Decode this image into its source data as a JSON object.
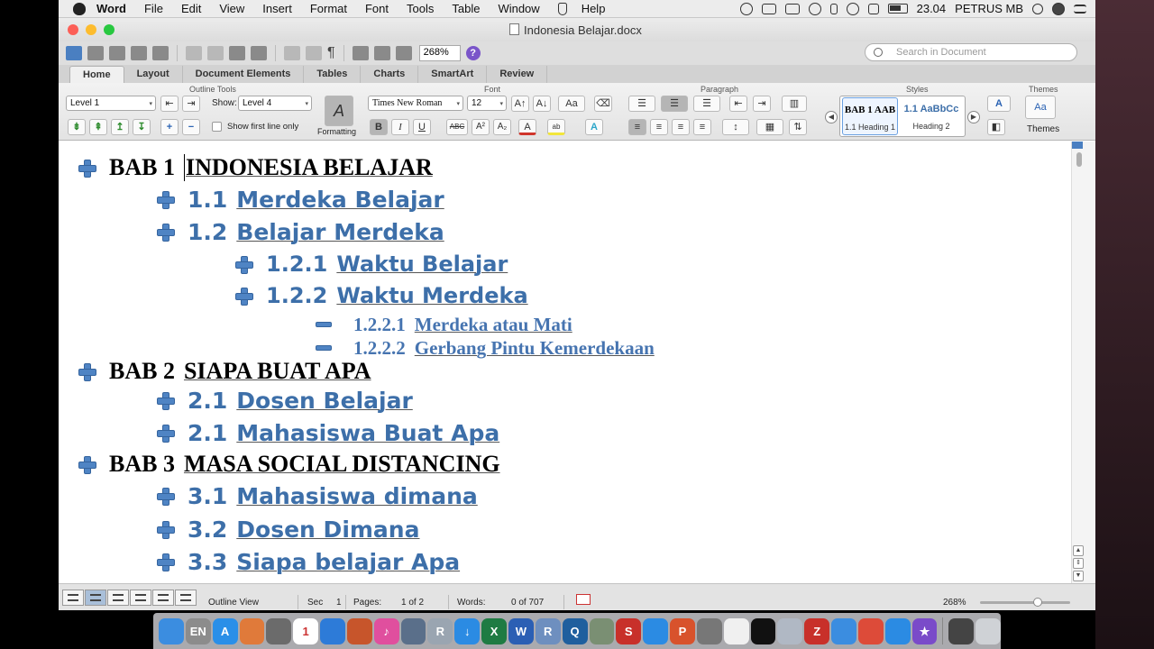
{
  "menubar": {
    "app": "Word",
    "items": [
      "File",
      "Edit",
      "View",
      "Insert",
      "Format",
      "Font",
      "Tools",
      "Table",
      "Window",
      "Help"
    ],
    "time": "23.04",
    "user": "PETRUS MB"
  },
  "window": {
    "title": "Indonesia Belajar.docx",
    "zoom": "268%",
    "search_placeholder": "Search in Document"
  },
  "ribbon": {
    "tabs": [
      "Home",
      "Layout",
      "Document Elements",
      "Tables",
      "Charts",
      "SmartArt",
      "Review"
    ],
    "groups": {
      "outline_tools": "Outline Tools",
      "font": "Font",
      "paragraph": "Paragraph",
      "styles": "Styles",
      "themes": "Themes"
    },
    "level_value": "Level 1",
    "show_label": "Show:",
    "show_value": "Level 4",
    "show_first_line": "Show first line only",
    "formatting_label": "Formatting",
    "font_name": "Times New Roman",
    "font_size": "12",
    "styles": [
      {
        "preview": "BAB 1  AAB",
        "caption": "1.1 Heading 1"
      },
      {
        "preview": "1.1  AaBbCc",
        "caption": "Heading 2"
      }
    ],
    "themes_label": "Themes",
    "buttons": {
      "bold": "B",
      "italic": "I",
      "underline": "U",
      "strike": "ABC",
      "superscript": "A²",
      "subscript": "A₂",
      "pilcrow": "¶",
      "themes_aa": "Aa",
      "font_aa": "A",
      "nav_prev": "◀",
      "nav_next": "▶",
      "help": "?",
      "dropdown_arrow": "▾",
      "scroll_up": "▲",
      "scroll_down": "▼",
      "scroll_updown": "⇕"
    }
  },
  "outline": [
    {
      "level": 1,
      "marker": "plus",
      "number": "BAB 1",
      "text": "INDONESIA BELAJAR"
    },
    {
      "level": 2,
      "marker": "plus",
      "number": "1.1",
      "text": "Merdeka Belajar"
    },
    {
      "level": 2,
      "marker": "plus",
      "number": "1.2",
      "text": "Belajar Merdeka"
    },
    {
      "level": 3,
      "marker": "plus",
      "number": "1.2.1",
      "text": "Waktu Belajar"
    },
    {
      "level": 3,
      "marker": "plus",
      "number": "1.2.2",
      "text": "Waktu Merdeka"
    },
    {
      "level": 4,
      "marker": "minus",
      "number": "1.2.2.1",
      "text": "Merdeka atau Mati"
    },
    {
      "level": 4,
      "marker": "minus",
      "number": "1.2.2.2",
      "text": "Gerbang Pintu Kemerdekaan"
    },
    {
      "level": 1,
      "marker": "plus",
      "number": "BAB 2",
      "text": "SIAPA BUAT APA"
    },
    {
      "level": 2,
      "marker": "plus",
      "number": "2.1",
      "text": "Dosen Belajar"
    },
    {
      "level": 2,
      "marker": "plus",
      "number": "2.1",
      "text": "Mahasiswa Buat Apa"
    },
    {
      "level": 1,
      "marker": "plus",
      "number": "BAB 3",
      "text": "MASA SOCIAL DISTANCING"
    },
    {
      "level": 2,
      "marker": "plus",
      "number": "3.1",
      "text": "Mahasiswa dimana"
    },
    {
      "level": 2,
      "marker": "plus",
      "number": "3.2",
      "text": "Dosen Dimana"
    },
    {
      "level": 2,
      "marker": "plus",
      "number": "3.3",
      "text": "Siapa belajar Apa"
    }
  ],
  "statusbar": {
    "view": "Outline View",
    "sec_label": "Sec",
    "sec_value": "1",
    "pages_label": "Pages:",
    "pages_value": "1 of 2",
    "words_label": "Words:",
    "words_value": "0 of 707",
    "zoom": "268%"
  },
  "dock": {
    "apps": [
      {
        "name": "finder",
        "glyph": "",
        "color": "#3b8de0"
      },
      {
        "name": "keyboard-en",
        "glyph": "EN",
        "color": "#8c8c8c"
      },
      {
        "name": "app-store",
        "glyph": "A",
        "color": "#2a8fe8"
      },
      {
        "name": "photos",
        "glyph": "",
        "color": "#e07a3a"
      },
      {
        "name": "brush",
        "glyph": "",
        "color": "#6b6b6b"
      },
      {
        "name": "calendar",
        "glyph": "1",
        "color": "#ffffff"
      },
      {
        "name": "keynote",
        "glyph": "",
        "color": "#2d7bd8"
      },
      {
        "name": "presentation",
        "glyph": "",
        "color": "#c7552b"
      },
      {
        "name": "itunes",
        "glyph": "♪",
        "color": "#e04f9e"
      },
      {
        "name": "scanner",
        "glyph": "",
        "color": "#5a6f8a"
      },
      {
        "name": "r-studio",
        "glyph": "R",
        "color": "#9aa5b1"
      },
      {
        "name": "downloader",
        "glyph": "↓",
        "color": "#2b8be3"
      },
      {
        "name": "excel",
        "glyph": "X",
        "color": "#1e7b43"
      },
      {
        "name": "word",
        "glyph": "W",
        "color": "#2b5fb4"
      },
      {
        "name": "r-app",
        "glyph": "R",
        "color": "#6e8fbf"
      },
      {
        "name": "quicktime",
        "glyph": "Q",
        "color": "#1f5f9e"
      },
      {
        "name": "network",
        "glyph": "",
        "color": "#7a8f73"
      },
      {
        "name": "presentation-red",
        "glyph": "S",
        "color": "#c8302a"
      },
      {
        "name": "safari",
        "glyph": "",
        "color": "#2b8be3"
      },
      {
        "name": "powerpoint",
        "glyph": "P",
        "color": "#d8522c"
      },
      {
        "name": "tools",
        "glyph": "",
        "color": "#777"
      },
      {
        "name": "notepad",
        "glyph": "",
        "color": "#f0f0f0"
      },
      {
        "name": "terminal",
        "glyph": "",
        "color": "#111"
      },
      {
        "name": "preview",
        "glyph": "",
        "color": "#b0b8c4"
      },
      {
        "name": "zotero",
        "glyph": "Z",
        "color": "#c8302a"
      },
      {
        "name": "blue-folder",
        "glyph": "",
        "color": "#3b8de0"
      },
      {
        "name": "chrome",
        "glyph": "",
        "color": "#dd4b39"
      },
      {
        "name": "blue-app",
        "glyph": "",
        "color": "#2b8be3"
      },
      {
        "name": "star-app",
        "glyph": "★",
        "color": "#7a4bc9"
      },
      {
        "name": "screen",
        "glyph": "",
        "color": "#444"
      },
      {
        "name": "trash",
        "glyph": "",
        "color": "#cfd2d6"
      }
    ]
  }
}
